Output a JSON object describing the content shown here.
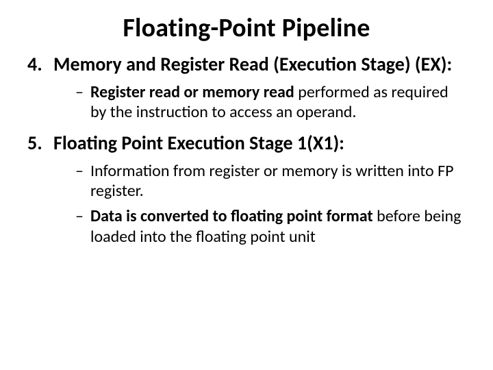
{
  "title": "Floating-Point Pipeline",
  "items": [
    {
      "num": "4.",
      "heading": "Memory and Register Read (Execution Stage) (EX):",
      "bullets": [
        {
          "bold": "Register read or memory read",
          "rest": " performed as required by the instruction to access an operand."
        }
      ]
    },
    {
      "num": "5.",
      "heading": "Floating Point Execution Stage 1(X1):",
      "bullets": [
        {
          "bold": "",
          "rest": "Information from register or memory is written into FP register."
        },
        {
          "bold": "Data is converted to floating point format",
          "rest": " before being loaded into the floating point unit"
        }
      ]
    }
  ]
}
